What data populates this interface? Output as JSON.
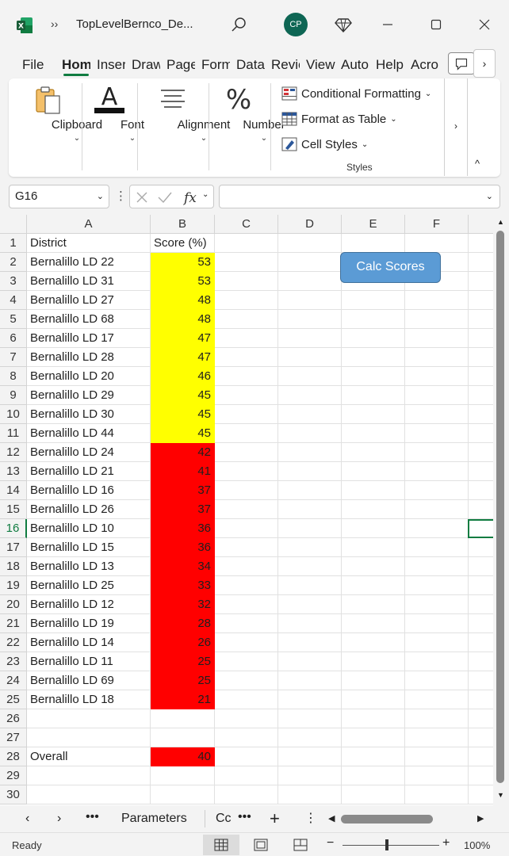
{
  "window": {
    "title": "TopLevelBernco_De...",
    "avatar_initials": "CP"
  },
  "ribbon_tabs": [
    {
      "label": "File"
    },
    {
      "label": "Hom"
    },
    {
      "label": "Inser"
    },
    {
      "label": "Draw"
    },
    {
      "label": "Page"
    },
    {
      "label": "Form"
    },
    {
      "label": "Data"
    },
    {
      "label": "Revie"
    },
    {
      "label": "View"
    },
    {
      "label": "Auto"
    },
    {
      "label": "Help"
    },
    {
      "label": "Acro"
    }
  ],
  "ribbon": {
    "clipboard": "Clipboard",
    "font": "Font",
    "alignment": "Alignment",
    "number": "Number",
    "conditional_formatting": "Conditional Formatting",
    "format_as_table": "Format as Table",
    "cell_styles": "Cell Styles",
    "styles_group": "Styles"
  },
  "formula_bar": {
    "name_box": "G16",
    "value": ""
  },
  "columns": [
    "A",
    "B",
    "C",
    "D",
    "E",
    "F"
  ],
  "rows": [
    {
      "n": "1",
      "a": "District",
      "b": "Score (%)",
      "fill": ""
    },
    {
      "n": "2",
      "a": "Bernalillo LD 22",
      "b": "53",
      "fill": "#ffff00"
    },
    {
      "n": "3",
      "a": "Bernalillo LD 31",
      "b": "53",
      "fill": "#ffff00"
    },
    {
      "n": "4",
      "a": "Bernalillo LD 27",
      "b": "48",
      "fill": "#ffff00"
    },
    {
      "n": "5",
      "a": "Bernalillo LD 68",
      "b": "48",
      "fill": "#ffff00"
    },
    {
      "n": "6",
      "a": "Bernalillo LD 17",
      "b": "47",
      "fill": "#ffff00"
    },
    {
      "n": "7",
      "a": "Bernalillo LD 28",
      "b": "47",
      "fill": "#ffff00"
    },
    {
      "n": "8",
      "a": "Bernalillo LD 20",
      "b": "46",
      "fill": "#ffff00"
    },
    {
      "n": "9",
      "a": "Bernalillo LD 29",
      "b": "45",
      "fill": "#ffff00"
    },
    {
      "n": "10",
      "a": "Bernalillo LD 30",
      "b": "45",
      "fill": "#ffff00"
    },
    {
      "n": "11",
      "a": "Bernalillo LD 44",
      "b": "45",
      "fill": "#ffff00"
    },
    {
      "n": "12",
      "a": "Bernalillo LD 24",
      "b": "42",
      "fill": "#ff0000"
    },
    {
      "n": "13",
      "a": "Bernalillo LD 21",
      "b": "41",
      "fill": "#ff0000"
    },
    {
      "n": "14",
      "a": "Bernalillo LD 16",
      "b": "37",
      "fill": "#ff0000"
    },
    {
      "n": "15",
      "a": "Bernalillo LD 26",
      "b": "37",
      "fill": "#ff0000"
    },
    {
      "n": "16",
      "a": "Bernalillo LD 10",
      "b": "36",
      "fill": "#ff0000"
    },
    {
      "n": "17",
      "a": "Bernalillo LD 15",
      "b": "36",
      "fill": "#ff0000"
    },
    {
      "n": "18",
      "a": "Bernalillo LD 13",
      "b": "34",
      "fill": "#ff0000"
    },
    {
      "n": "19",
      "a": "Bernalillo LD 25",
      "b": "33",
      "fill": "#ff0000"
    },
    {
      "n": "20",
      "a": "Bernalillo LD 12",
      "b": "32",
      "fill": "#ff0000"
    },
    {
      "n": "21",
      "a": "Bernalillo LD 19",
      "b": "28",
      "fill": "#ff0000"
    },
    {
      "n": "22",
      "a": "Bernalillo LD 14",
      "b": "26",
      "fill": "#ff0000"
    },
    {
      "n": "23",
      "a": "Bernalillo LD 11",
      "b": "25",
      "fill": "#ff0000"
    },
    {
      "n": "24",
      "a": "Bernalillo LD 69",
      "b": "25",
      "fill": "#ff0000"
    },
    {
      "n": "25",
      "a": "Bernalillo LD 18",
      "b": "21",
      "fill": "#ff0000"
    },
    {
      "n": "26",
      "a": "",
      "b": "",
      "fill": ""
    },
    {
      "n": "27",
      "a": "",
      "b": "",
      "fill": ""
    },
    {
      "n": "28",
      "a": "Overall",
      "b": "40",
      "fill": "#ff0000"
    },
    {
      "n": "29",
      "a": "",
      "b": "",
      "fill": ""
    },
    {
      "n": "30",
      "a": "",
      "b": "",
      "fill": ""
    }
  ],
  "selected_row": "16",
  "calc_button": "Calc Scores",
  "sheet_tabs": {
    "parameters": "Parameters",
    "next": "Cc"
  },
  "status": {
    "text": "Ready",
    "zoom": "100%",
    "zoom_fraction": 0.46
  }
}
